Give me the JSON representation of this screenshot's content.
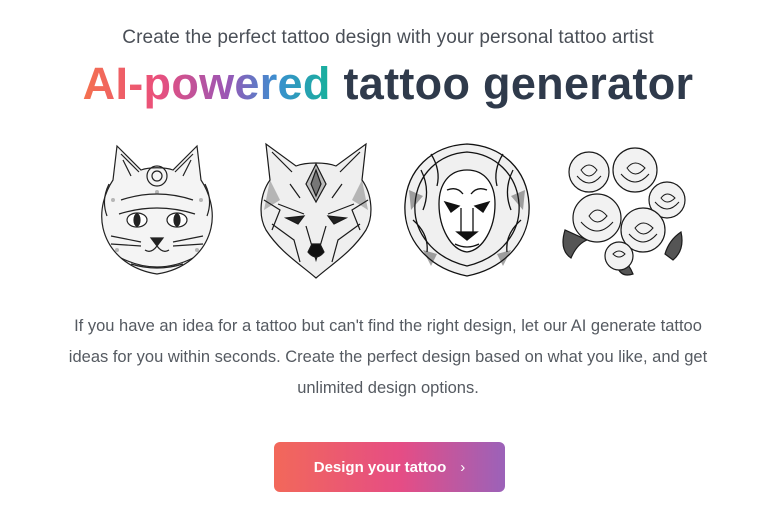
{
  "header": {
    "subtitle": "Create the perfect tattoo design with your personal tattoo artist",
    "headline_gradient": "AI-powered",
    "headline_plain": "tattoo generator"
  },
  "gallery": {
    "items": [
      {
        "icon": "cat-tattoo-illustration"
      },
      {
        "icon": "wolf-tattoo-illustration"
      },
      {
        "icon": "lion-tattoo-illustration"
      },
      {
        "icon": "roses-tattoo-illustration"
      }
    ]
  },
  "body": {
    "description": "If you have an idea for a tattoo but can't find the right design, let our AI generate tattoo ideas for you within seconds. Create the perfect design based on what you like, and get unlimited design options."
  },
  "cta": {
    "label": "Design your tattoo",
    "icon": "chevron-right-icon",
    "gradient_start": "#f2685a",
    "gradient_mid": "#e54d85",
    "gradient_end": "#9b62b9"
  },
  "colors": {
    "headline_gradient": [
      "#f4714f",
      "#ea4f7c",
      "#9b56b5",
      "#3a8fd0",
      "#17b19a"
    ],
    "headline_text": "#2f3a4b",
    "body_text": "#555a61"
  }
}
